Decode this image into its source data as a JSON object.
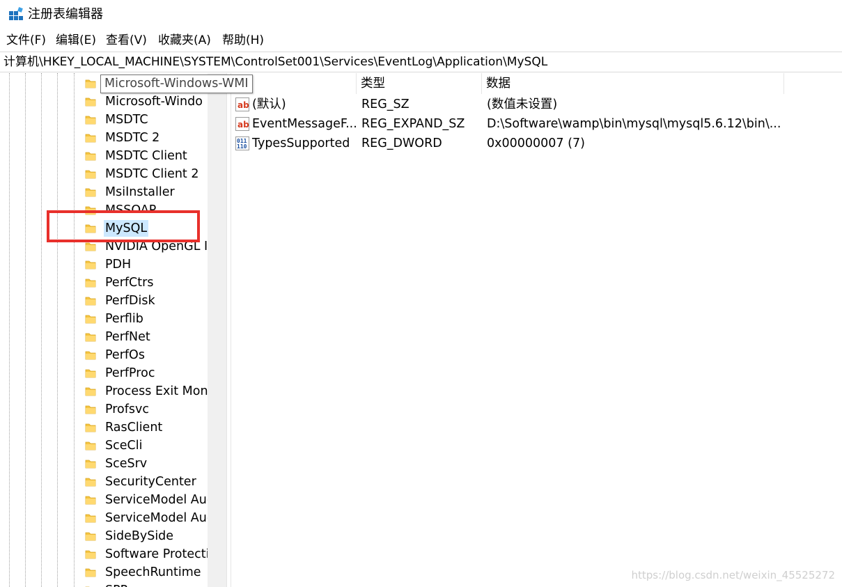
{
  "window": {
    "title": "注册表编辑器",
    "app_icon": "registry-icon"
  },
  "menu": [
    {
      "label": "文件(F)"
    },
    {
      "label": "编辑(E)"
    },
    {
      "label": "查看(V)"
    },
    {
      "label": "收藏夹(A)"
    },
    {
      "label": "帮助(H)"
    }
  ],
  "address": {
    "path": "计算机\\HKEY_LOCAL_MACHINE\\SYSTEM\\ControlSet001\\Services\\EventLog\\Application\\MySQL"
  },
  "tree": {
    "tooltip": "Microsoft-Windows-WMI",
    "items": [
      {
        "label": ""
      },
      {
        "label": "Microsoft-Windo"
      },
      {
        "label": "MSDTC"
      },
      {
        "label": "MSDTC 2"
      },
      {
        "label": "MSDTC Client"
      },
      {
        "label": "MSDTC Client 2"
      },
      {
        "label": "MsiInstaller"
      },
      {
        "label": "MSSOAP"
      },
      {
        "label": "MySQL",
        "selected": true
      },
      {
        "label": "NVIDIA OpenGL I"
      },
      {
        "label": "PDH"
      },
      {
        "label": "PerfCtrs"
      },
      {
        "label": "PerfDisk"
      },
      {
        "label": "Perflib"
      },
      {
        "label": "PerfNet"
      },
      {
        "label": "PerfOs"
      },
      {
        "label": "PerfProc"
      },
      {
        "label": "Process Exit Moni"
      },
      {
        "label": "Profsvc"
      },
      {
        "label": "RasClient"
      },
      {
        "label": "SceCli"
      },
      {
        "label": "SceSrv"
      },
      {
        "label": "SecurityCenter"
      },
      {
        "label": "ServiceModel Auc"
      },
      {
        "label": "ServiceModel Auc"
      },
      {
        "label": "SideBySide"
      },
      {
        "label": "Software Protecti"
      },
      {
        "label": "SpeechRuntime"
      },
      {
        "label": "SPP"
      }
    ]
  },
  "values": {
    "columns": [
      {
        "label": ""
      },
      {
        "label": "类型"
      },
      {
        "label": "数据"
      }
    ],
    "rows": [
      {
        "icon": "string-value-icon",
        "name": "(默认)",
        "type": "REG_SZ",
        "data": "(数值未设置)"
      },
      {
        "icon": "string-value-icon",
        "name": "EventMessageF...",
        "type": "REG_EXPAND_SZ",
        "data": "D:\\Software\\wamp\\bin\\mysql\\mysql5.6.12\\bin\\..."
      },
      {
        "icon": "binary-value-icon",
        "name": "TypesSupported",
        "type": "REG_DWORD",
        "data": "0x00000007 (7)"
      }
    ]
  },
  "watermark": "https://blog.csdn.net/weixin_45525272",
  "colors": {
    "selection": "#cce8ff",
    "highlight_box": "#e8302b",
    "folder": "#f5c542"
  }
}
